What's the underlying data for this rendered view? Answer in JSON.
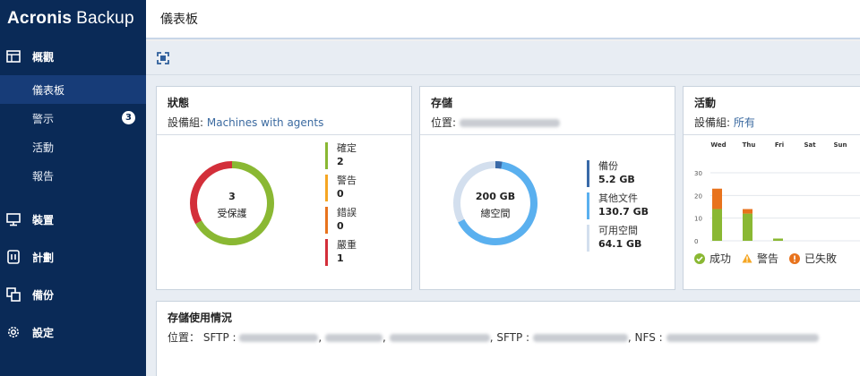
{
  "brand": {
    "name_bold": "Acronis",
    "name_regular": "Backup"
  },
  "sidebar": {
    "overview_label": "概觀",
    "sub_items": [
      {
        "label": "儀表板"
      },
      {
        "label": "警示",
        "badge": "3"
      },
      {
        "label": "活動"
      },
      {
        "label": "報告"
      }
    ],
    "devices_label": "裝置",
    "plans_label": "計劃",
    "backups_label": "備份",
    "settings_label": "設定"
  },
  "header": {
    "title": "儀表板"
  },
  "status_card": {
    "title": "狀態",
    "group_label": "設備組:",
    "group_value": "Machines with agents",
    "center_value": "3",
    "center_label": "受保護",
    "legend": [
      {
        "label": "確定",
        "value": "2",
        "color": "#8ab833"
      },
      {
        "label": "警告",
        "value": "0",
        "color": "#f5a623"
      },
      {
        "label": "錯誤",
        "value": "0",
        "color": "#e8731d"
      },
      {
        "label": "嚴重",
        "value": "1",
        "color": "#d32f3a"
      }
    ]
  },
  "storage_card": {
    "title": "存儲",
    "location_label": "位置:",
    "center_value": "200 GB",
    "center_label": "總空間",
    "legend": [
      {
        "label": "備份",
        "value": "5.2 GB",
        "color": "#3a6aa8"
      },
      {
        "label": "其他文件",
        "value": "130.7 GB",
        "color": "#5ab0ef"
      },
      {
        "label": "可用空間",
        "value": "64.1 GB",
        "color": "#d3dfee"
      }
    ]
  },
  "activity_card": {
    "title": "活動",
    "group_label": "設備組:",
    "group_value": "所有",
    "legend": [
      {
        "label": "成功",
        "color": "#8ab833"
      },
      {
        "label": "警告",
        "color": "#f5a623"
      },
      {
        "label": "已失敗",
        "color": "#e8731d"
      }
    ]
  },
  "chart_data": {
    "type": "bar",
    "stacked": true,
    "categories": [
      "Wed",
      "Thu",
      "Fri",
      "Sat",
      "Sun"
    ],
    "y_ticks": [
      "0",
      "10",
      "20",
      "30"
    ],
    "ylim": [
      0,
      30
    ],
    "grid": true,
    "series": [
      {
        "name": "成功",
        "color": "#8ab833",
        "values": [
          14,
          12,
          1,
          0,
          0
        ]
      },
      {
        "name": "警告",
        "color": "#f5a623",
        "values": [
          0,
          0,
          0,
          0,
          0
        ]
      },
      {
        "name": "已失敗",
        "color": "#e8731d",
        "values": [
          9,
          2,
          0,
          0,
          0
        ]
      }
    ]
  },
  "usage_card": {
    "title": "存儲使用情況",
    "location_label": "位置：",
    "types": [
      "SFTP :",
      "SFTP :",
      "NFS :"
    ]
  }
}
